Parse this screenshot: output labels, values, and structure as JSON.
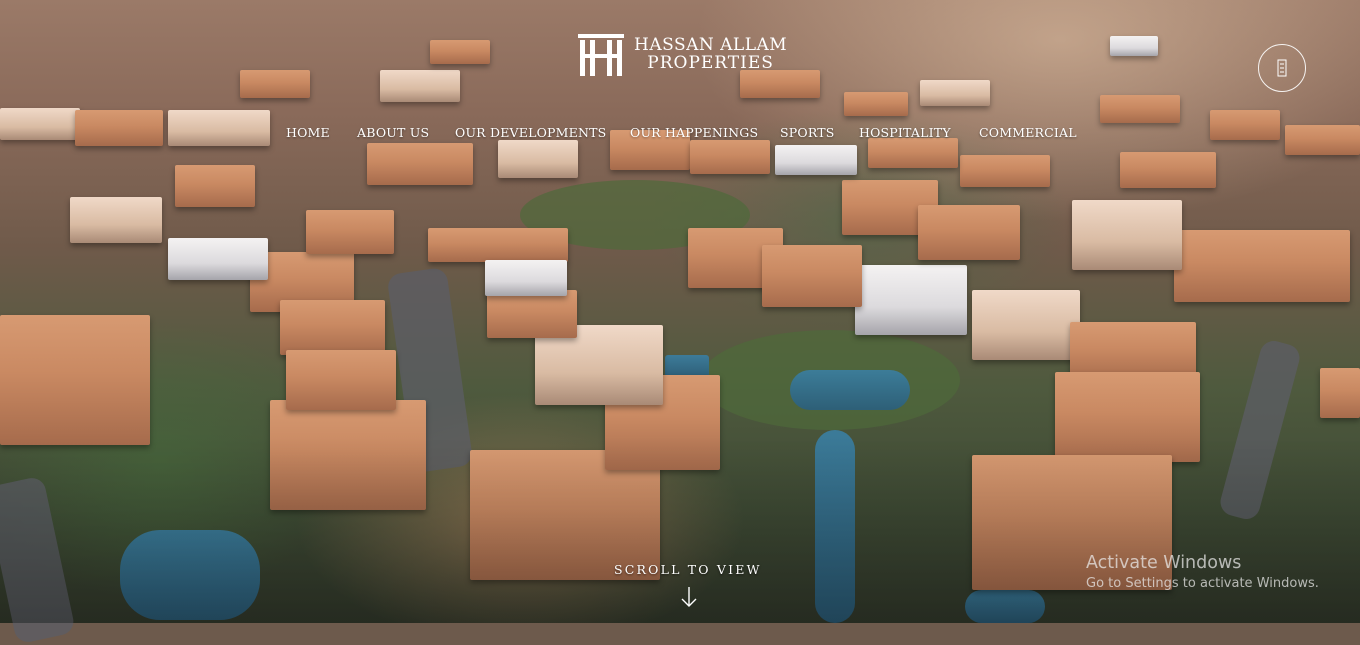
{
  "brand": {
    "name_line1": "HASSAN ALLAM",
    "name_line2": "PROPERTIES",
    "logo_icon": "ha-monogram-logo"
  },
  "header": {
    "menu_button_icon": "menu-icon"
  },
  "nav": {
    "items": [
      {
        "label": "HOME"
      },
      {
        "label": "ABOUT US"
      },
      {
        "label": "OUR DEVELOPMENTS"
      },
      {
        "label": "OUR HAPPENINGS"
      },
      {
        "label": "SPORTS"
      },
      {
        "label": "HOSPITALITY"
      },
      {
        "label": "COMMERCIAL"
      }
    ]
  },
  "hero": {
    "scroll_label": "SCROLL TO VIEW",
    "scroll_icon": "arrow-down-icon"
  },
  "os_overlay": {
    "title": "Activate Windows",
    "subtitle": "Go to Settings to activate Windows."
  },
  "colors": {
    "nav_text": "#ffffff",
    "logo": "#ffffff"
  }
}
